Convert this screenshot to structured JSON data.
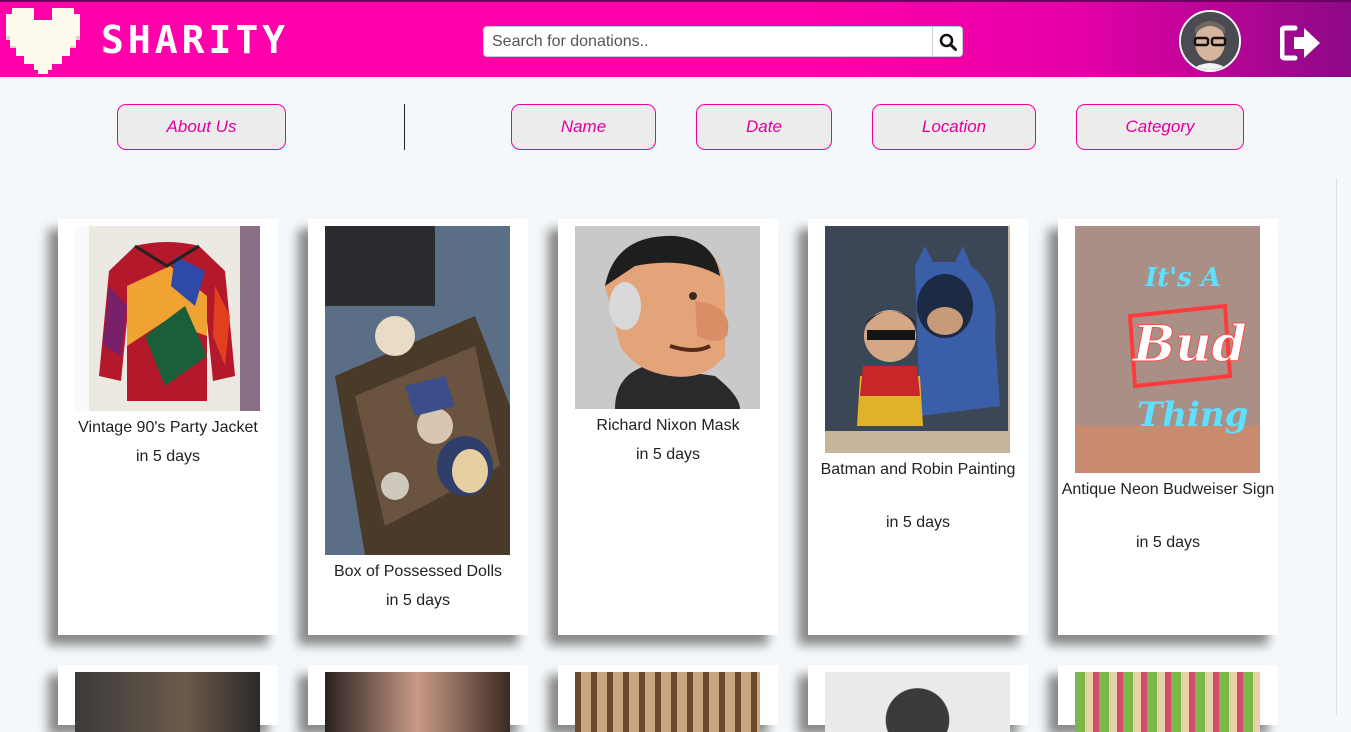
{
  "app": {
    "brand": "SHARITY"
  },
  "search": {
    "placeholder": "Search for donations.."
  },
  "nav": {
    "about": "About Us",
    "sorts": [
      "Name",
      "Date",
      "Location",
      "Category"
    ]
  },
  "icons": {
    "logo": "pixel-heart-icon",
    "search": "search-icon",
    "logout": "logout-icon"
  },
  "colors": {
    "accent": "#ff00aa",
    "accent_dark": "#8c0a86",
    "nav_text": "#e000a0"
  },
  "items": [
    {
      "title": "Vintage 90's Party Jacket",
      "when": "in 5 days"
    },
    {
      "title": "Box of Possessed Dolls",
      "when": "in 5 days"
    },
    {
      "title": "Richard Nixon Mask",
      "when": "in 5 days"
    },
    {
      "title": "Batman and Robin Painting",
      "when": "in 5 days"
    },
    {
      "title": "Antique Neon Budweiser Sign",
      "when": "in 5 days"
    }
  ]
}
